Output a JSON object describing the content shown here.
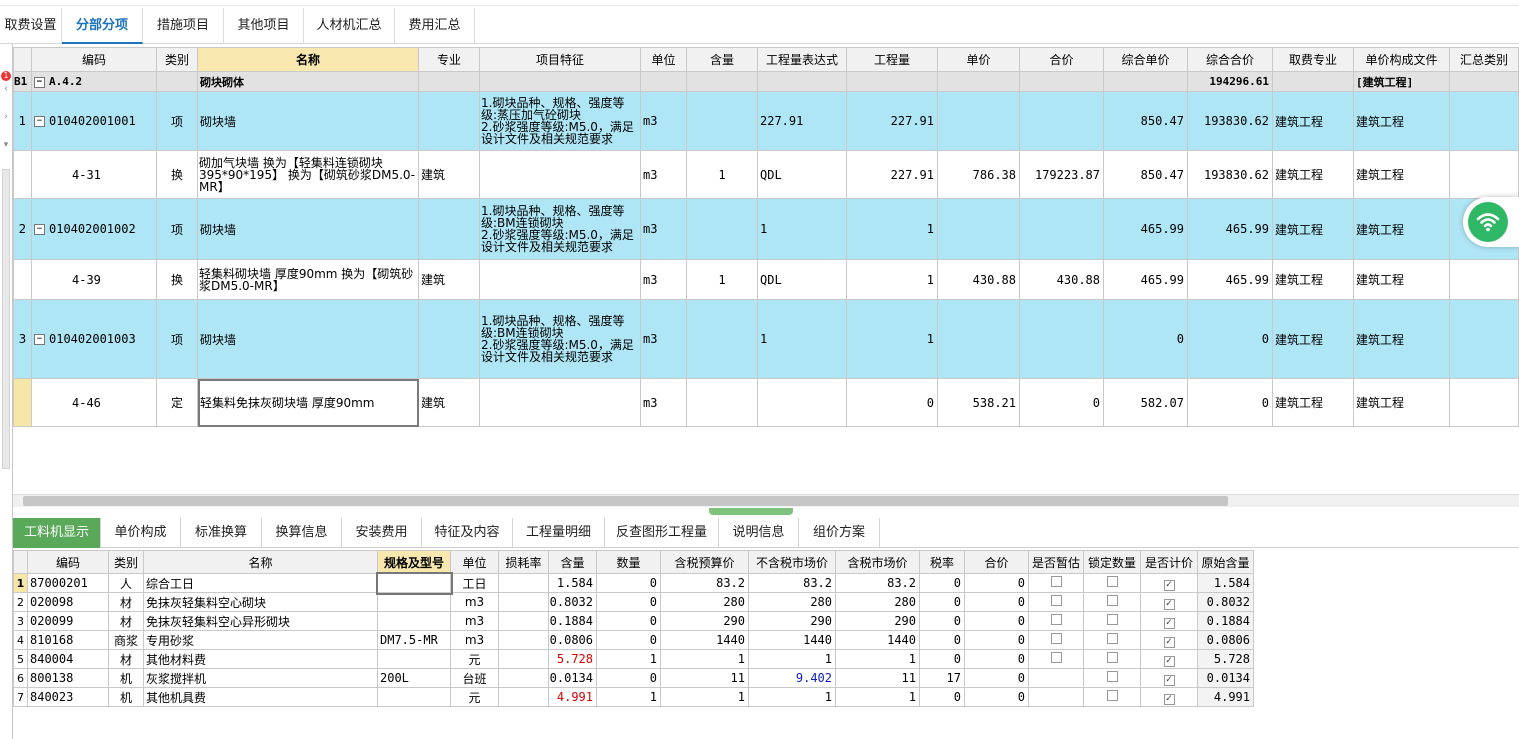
{
  "tabs": [
    "取费设置",
    "分部分项",
    "措施项目",
    "其他项目",
    "人材机汇总",
    "费用汇总"
  ],
  "badge": "1",
  "main_headers": [
    "编码",
    "类别",
    "名称",
    "专业",
    "项目特征",
    "单位",
    "含量",
    "工程量表达式",
    "工程量",
    "单价",
    "合价",
    "综合单价",
    "综合合价",
    "取费专业",
    "单价构成文件",
    "汇总类别"
  ],
  "group_row": {
    "num": "B1",
    "code": "A.4.2",
    "name": "砌块砌体",
    "total": "194296.61",
    "file": "[建筑工程]"
  },
  "rows": [
    {
      "num": "1",
      "code": "010402001001",
      "type": "项",
      "name": "砌块墙",
      "major": "",
      "feature": "1.砌块品种、规格、强度等级:蒸压加气砼砌块\n2.砂浆强度等级:M5.0，满足设计文件及相关规范要求",
      "unit": "m3",
      "content": "",
      "expr": "227.91",
      "qty": "227.91",
      "price": "",
      "amount": "",
      "uprice": "850.47",
      "uamount": "193830.62",
      "feemajor": "建筑工程",
      "file": "建筑工程"
    },
    {
      "num": "",
      "code": "4-31",
      "type": "换",
      "name": "砌加气块墙  换为【轻集料连锁砌块395*90*195】  换为【砌筑砂浆DM5.0-MR】",
      "major": "建筑",
      "feature": "",
      "unit": "m3",
      "content": "1",
      "expr": "QDL",
      "qty": "227.91",
      "price": "786.38",
      "amount": "179223.87",
      "uprice": "850.47",
      "uamount": "193830.62",
      "feemajor": "建筑工程",
      "file": "建筑工程"
    },
    {
      "num": "2",
      "code": "010402001002",
      "type": "项",
      "name": "砌块墙",
      "major": "",
      "feature": "1.砌块品种、规格、强度等级:BM连锁砌块\n2.砂浆强度等级:M5.0，满足设计文件及相关规范要求",
      "unit": "m3",
      "content": "",
      "expr": "1",
      "qty": "1",
      "price": "",
      "amount": "",
      "uprice": "465.99",
      "uamount": "465.99",
      "feemajor": "建筑工程",
      "file": "建筑工程"
    },
    {
      "num": "",
      "code": "4-39",
      "type": "换",
      "name": "轻集料砌块墙 厚度90mm  换为【砌筑砂浆DM5.0-MR】",
      "major": "建筑",
      "feature": "",
      "unit": "m3",
      "content": "1",
      "expr": "QDL",
      "qty": "1",
      "price": "430.88",
      "amount": "430.88",
      "uprice": "465.99",
      "uamount": "465.99",
      "feemajor": "建筑工程",
      "file": "建筑工程"
    },
    {
      "num": "3",
      "code": "010402001003",
      "type": "项",
      "name": "砌块墙",
      "major": "",
      "feature": "1.砌块品种、规格、强度等级:BM连锁砌块\n2.砂浆强度等级:M5.0，满足设计文件及相关规范要求",
      "unit": "m3",
      "content": "",
      "expr": "1",
      "qty": "1",
      "price": "",
      "amount": "",
      "uprice": "0",
      "uamount": "0",
      "feemajor": "建筑工程",
      "file": "建筑工程"
    },
    {
      "num": "",
      "code": "4-46",
      "type": "定",
      "name": "轻集料免抹灰砌块墙 厚度90mm",
      "major": "建筑",
      "feature": "",
      "unit": "m3",
      "content": "",
      "expr": "",
      "qty": "0",
      "price": "538.21",
      "amount": "0",
      "uprice": "582.07",
      "uamount": "0",
      "feemajor": "建筑工程",
      "file": "建筑工程"
    }
  ],
  "bottom_tabs": [
    "工料机显示",
    "单价构成",
    "标准换算",
    "换算信息",
    "安装费用",
    "特征及内容",
    "工程量明细",
    "反查图形工程量",
    "说明信息",
    "组价方案"
  ],
  "sub_headers": [
    "编码",
    "类别",
    "名称",
    "规格及型号",
    "单位",
    "损耗率",
    "含量",
    "数量",
    "含税预算价",
    "不含税市场价",
    "含税市场价",
    "税率",
    "合价",
    "是否暂估",
    "锁定数量",
    "是否计价",
    "原始含量"
  ],
  "sub_rows": [
    {
      "num": "1",
      "code": "87000201",
      "type": "人",
      "name": "综合工日",
      "spec": "",
      "unit": "工日",
      "loss": "",
      "content": "1.584",
      "qty": "0",
      "tbp": "83.2",
      "ntmp": "83.2",
      "tmp": "83.2",
      "tax": "0",
      "amount": "0",
      "est": false,
      "lock": false,
      "price": true,
      "orig": "1.584"
    },
    {
      "num": "2",
      "code": "020098",
      "type": "材",
      "name": "免抹灰轻集料空心砌块",
      "spec": "",
      "unit": "m3",
      "loss": "",
      "content": "0.8032",
      "qty": "0",
      "tbp": "280",
      "ntmp": "280",
      "tmp": "280",
      "tax": "0",
      "amount": "0",
      "est": false,
      "lock": false,
      "price": true,
      "orig": "0.8032"
    },
    {
      "num": "3",
      "code": "020099",
      "type": "材",
      "name": "免抹灰轻集料空心异形砌块",
      "spec": "",
      "unit": "m3",
      "loss": "",
      "content": "0.1884",
      "qty": "0",
      "tbp": "290",
      "ntmp": "290",
      "tmp": "290",
      "tax": "0",
      "amount": "0",
      "est": false,
      "lock": false,
      "price": true,
      "orig": "0.1884"
    },
    {
      "num": "4",
      "code": "810168",
      "type": "商浆",
      "name": "专用砂浆",
      "spec": "DM7.5-MR",
      "unit": "m3",
      "loss": "",
      "content": "0.0806",
      "qty": "0",
      "tbp": "1440",
      "ntmp": "1440",
      "tmp": "1440",
      "tax": "0",
      "amount": "0",
      "est": false,
      "lock": false,
      "price": true,
      "orig": "0.0806"
    },
    {
      "num": "5",
      "code": "840004",
      "type": "材",
      "name": "其他材料费",
      "spec": "",
      "unit": "元",
      "loss": "",
      "content": "5.728",
      "qty": "1",
      "tbp": "1",
      "ntmp": "1",
      "tmp": "1",
      "tax": "0",
      "amount": "0",
      "est": false,
      "lock": false,
      "price": true,
      "orig": "5.728"
    },
    {
      "num": "6",
      "code": "800138",
      "type": "机",
      "name": "灰浆搅拌机",
      "spec": "200L",
      "unit": "台班",
      "loss": "",
      "content": "0.0134",
      "qty": "0",
      "tbp": "11",
      "ntmp": "9.402",
      "tmp": "11",
      "tax": "17",
      "amount": "0",
      "est": null,
      "lock": false,
      "price": true,
      "orig": "0.0134"
    },
    {
      "num": "7",
      "code": "840023",
      "type": "机",
      "name": "其他机具费",
      "spec": "",
      "unit": "元",
      "loss": "",
      "content": "4.991",
      "qty": "1",
      "tbp": "1",
      "ntmp": "1",
      "tmp": "1",
      "tax": "0",
      "amount": "0",
      "est": null,
      "lock": false,
      "price": true,
      "orig": "4.991"
    }
  ],
  "colors": {
    "accent": "#1e73be",
    "item_row": "#aee6f6",
    "active_tab": "#5aa85a",
    "red_value": "#d40000",
    "blue_value": "#1020c0"
  },
  "icons": [
    "minus-expand-icon",
    "wifi-icon",
    "checkbox-icon"
  ]
}
